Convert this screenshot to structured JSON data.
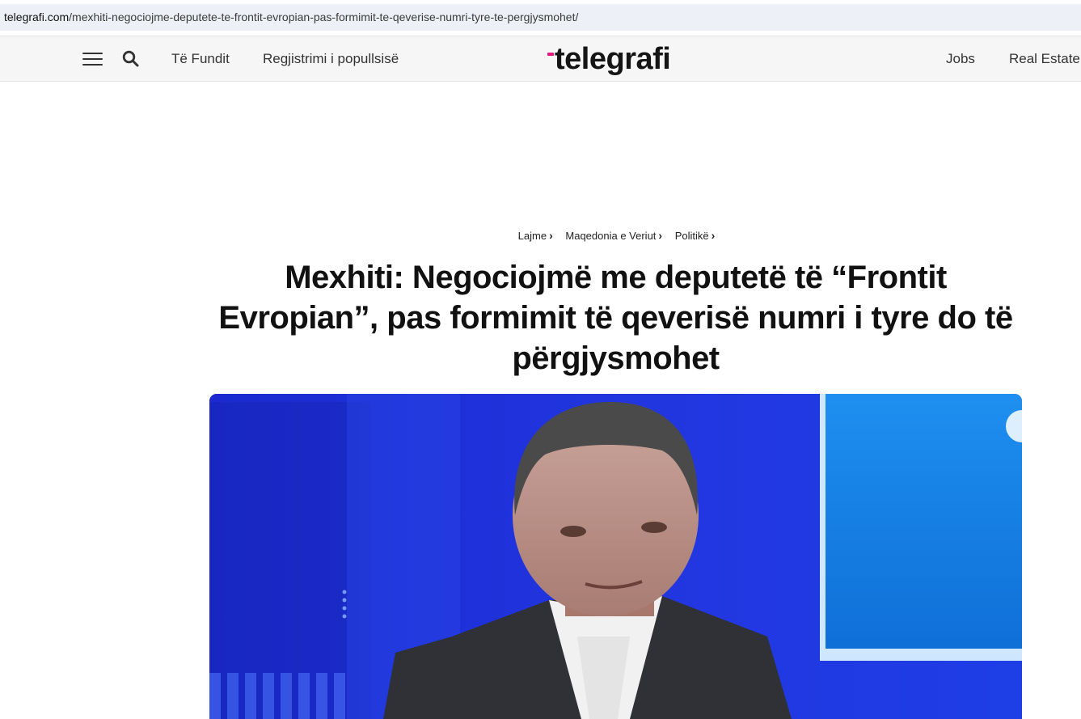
{
  "browser": {
    "url_domain": "telegrafi.com",
    "url_path": "/mexhiti-negociojme-deputete-te-frontit-evropian-pas-formimit-te-qeverise-numri-tyre-te-pergjysmohet/"
  },
  "nav": {
    "left_links": [
      "Të Fundit",
      "Regjistrimi i popullsisë"
    ],
    "logo_text": "telegrafi",
    "right_links": [
      "Jobs",
      "Real Estate"
    ],
    "icons": [
      "menu-icon",
      "search-icon"
    ]
  },
  "article": {
    "breadcrumb": [
      "Lajme",
      "Maqedonia e Veriut",
      "Politikë"
    ],
    "title": "Mexhiti: Negociojmë me deputetë të “Frontit Evropian”, pas formimit të qeverisë numri i tyre do të përgjysmohet"
  },
  "colors": {
    "logo_accent": "#e5157a",
    "hero_background": "#1d2fd6"
  }
}
